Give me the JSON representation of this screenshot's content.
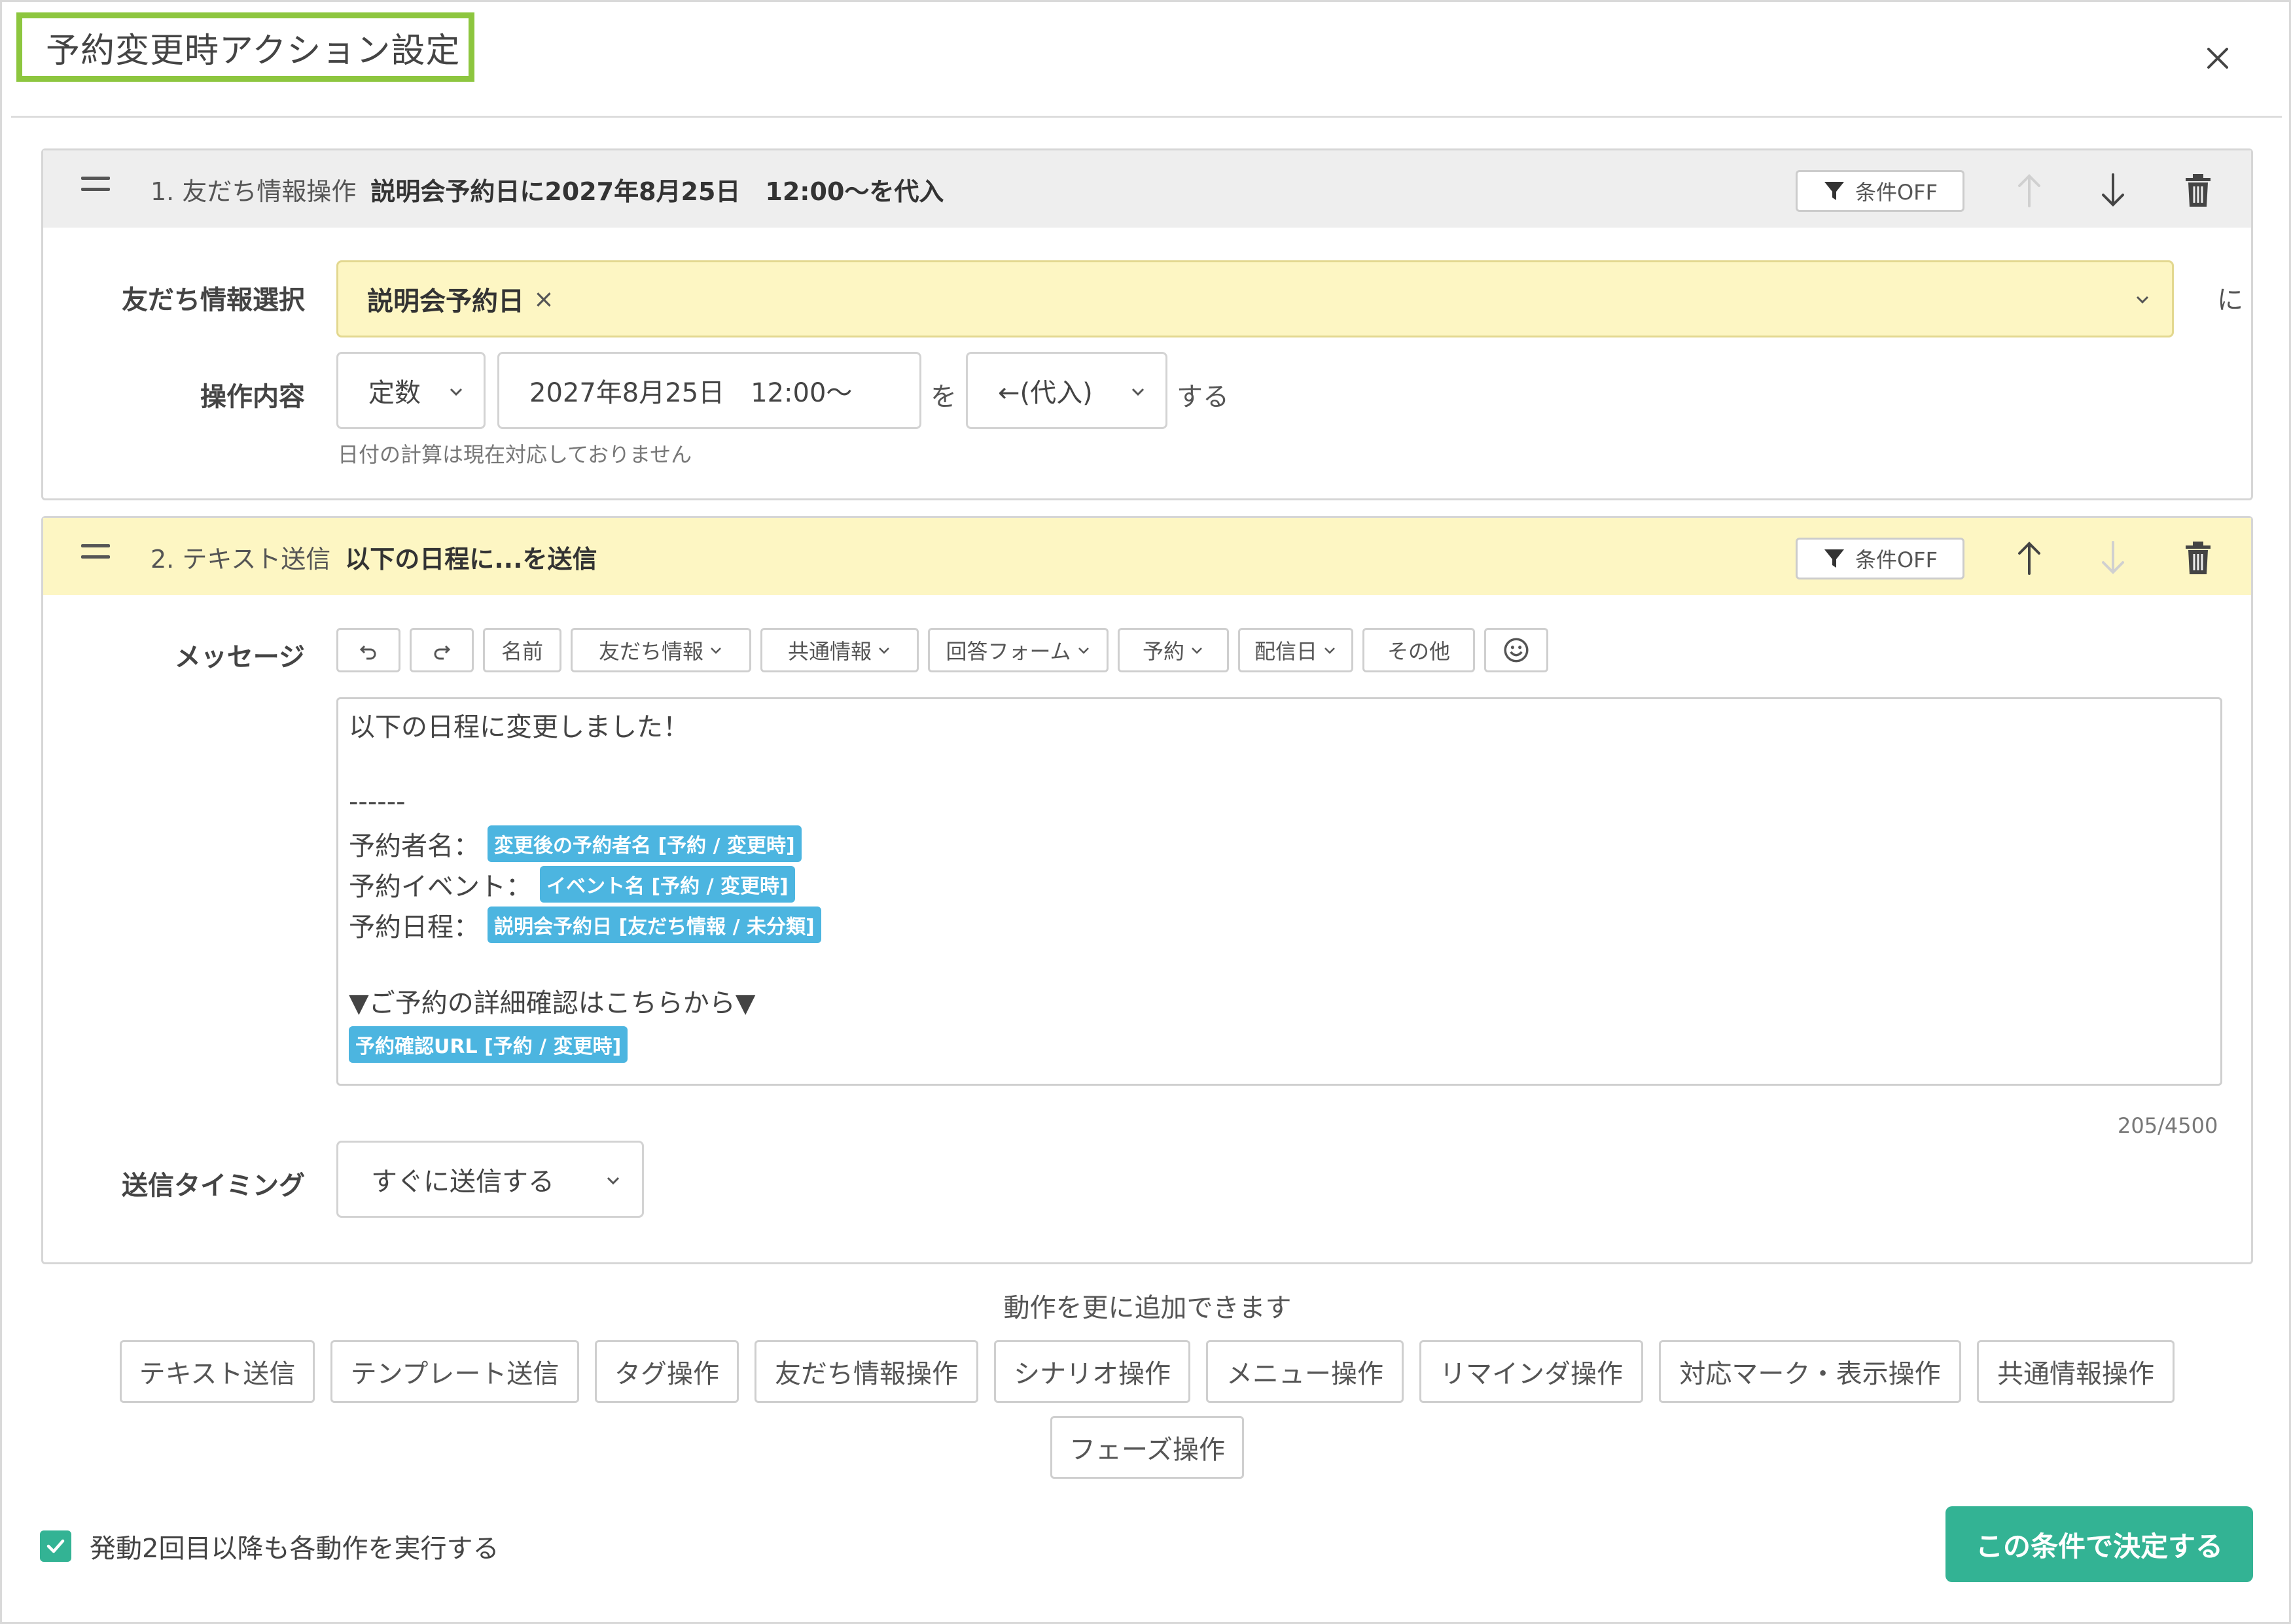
{
  "modal": {
    "title": "予約変更時アクション設定",
    "close_icon": "close-icon"
  },
  "action1": {
    "number": "1. 友だち情報操作",
    "summary": "説明会予約日に2027年8月25日　12:00〜を代入",
    "condition_label": "条件OFF",
    "friend_label": "友だち情報選択",
    "friend_value": "説明会予約日",
    "friend_remove": "×",
    "friend_suffix": "に",
    "op_label": "操作内容",
    "op_type": "定数",
    "op_value": "2027年8月25日　12:00〜",
    "wo": "を",
    "op_mode": "←(代入)",
    "suru": "する",
    "hint": "日付の計算は現在対応しておりません"
  },
  "action2": {
    "number": "2. テキスト送信",
    "summary": "以下の日程に...を送信",
    "condition_label": "条件OFF",
    "message_label": "メッセージ",
    "toolbar": {
      "name": "名前",
      "friend_info": "友だち情報",
      "common_info": "共通情報",
      "answer_form": "回答フォーム",
      "reservation": "予約",
      "delivery_date": "配信日",
      "other": "その他"
    },
    "editor": {
      "line1": "以下の日程に変更しました！",
      "line2": "------",
      "line3_prefix": "予約者名：",
      "line3_tag": "変更後の予約者名 [予約 / 変更時]",
      "line4_prefix": "予約イベント：",
      "line4_tag": "イベント名 [予約 / 変更時]",
      "line5_prefix": "予約日程：",
      "line5_tag": "説明会予約日 [友だち情報 / 未分類]",
      "line6": "▼ご予約の詳細確認はこちらから▼",
      "line7_tag": "予約確認URL [予約 / 変更時]"
    },
    "counter": "205/4500",
    "timing_label": "送信タイミング",
    "timing_value": "すぐに送信する"
  },
  "add_actions": {
    "caption": "動作を更に追加できます",
    "buttons": [
      "テキスト送信",
      "テンプレート送信",
      "タグ操作",
      "友だち情報操作",
      "シナリオ操作",
      "メニュー操作",
      "リマインダ操作",
      "対応マーク・表示操作",
      "共通情報操作",
      "フェーズ操作"
    ]
  },
  "footer": {
    "checkbox_label": "発動2回目以降も各動作を実行する",
    "checkbox_checked": true,
    "submit_label": "この条件で決定する"
  },
  "colors": {
    "accent_green": "#33b394",
    "title_border": "#8dc63f",
    "tag_blue": "#4cb5e0",
    "highlight_yellow": "#fdf6c3"
  }
}
